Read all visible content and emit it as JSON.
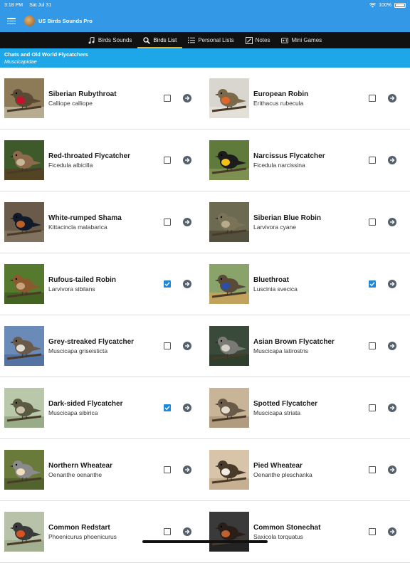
{
  "status_bar": {
    "time": "3:18 PM",
    "date": "Sat Jul 31",
    "battery": "100%"
  },
  "app": {
    "title": "US Birds Sounds Pro"
  },
  "tabs": [
    {
      "label": "Birds Sounds",
      "icon": "music-note-icon",
      "active": false
    },
    {
      "label": "Birds List",
      "icon": "search-icon",
      "active": true
    },
    {
      "label": "Personal Lists",
      "icon": "list-icon",
      "active": false
    },
    {
      "label": "Notes",
      "icon": "edit-note-icon",
      "active": false
    },
    {
      "label": "Mini Games",
      "icon": "gamepad-icon",
      "active": false
    }
  ],
  "section": {
    "title": "Chats and Old World Flycatchers",
    "family": "Muscicapidae"
  },
  "birds": [
    {
      "common": "Siberian Rubythroat",
      "scientific": "Calliope calliope",
      "checked": false,
      "palette": [
        "#8d7a57",
        "#5a4a35",
        "#c8102e",
        "#c9c0a8"
      ]
    },
    {
      "common": "European Robin",
      "scientific": "Erithacus rubecula",
      "checked": false,
      "palette": [
        "#d9d6cf",
        "#7a6a4a",
        "#e2662a",
        "#e8e4dc"
      ]
    },
    {
      "common": "Red-throated Flycatcher",
      "scientific": "Ficedula albicilla",
      "checked": false,
      "palette": [
        "#3f5a2a",
        "#8a6a4a",
        "#c9b79a",
        "#5c3b22"
      ]
    },
    {
      "common": "Narcissus Flycatcher",
      "scientific": "Ficedula narcissina",
      "checked": false,
      "palette": [
        "#5f7a3a",
        "#1c1c1c",
        "#f2c018",
        "#8a9a5a"
      ]
    },
    {
      "common": "White-rumped Shama",
      "scientific": "Kittacincla malabarica",
      "checked": false,
      "palette": [
        "#6a5a4a",
        "#111a2a",
        "#b8602a",
        "#8b7b68"
      ]
    },
    {
      "common": "Siberian Blue Robin",
      "scientific": "Larvivora cyane",
      "checked": false,
      "palette": [
        "#6d6a52",
        "#7a7358",
        "#b7ab8e",
        "#4a4636"
      ]
    },
    {
      "common": "Rufous-tailed Robin",
      "scientific": "Larvivora sibilans",
      "checked": true,
      "palette": [
        "#557a2e",
        "#8a5a2e",
        "#c7a27a",
        "#3d5a1f"
      ]
    },
    {
      "common": "Bluethroat",
      "scientific": "Luscinia svecica",
      "checked": true,
      "palette": [
        "#8aa36a",
        "#5a4a3a",
        "#2a4fa8",
        "#d9a25a"
      ]
    },
    {
      "common": "Grey-streaked Flycatcher",
      "scientific": "Muscicapa griseisticta",
      "checked": false,
      "palette": [
        "#6a8ab8",
        "#6a5a4a",
        "#e0dcd2",
        "#4a6a98"
      ]
    },
    {
      "common": "Asian Brown Flycatcher",
      "scientific": "Muscicapa latirostris",
      "checked": false,
      "palette": [
        "#3a4a3a",
        "#7a7a74",
        "#d4d0c8",
        "#2a3a2a"
      ]
    },
    {
      "common": "Dark-sided Flycatcher",
      "scientific": "Muscicapa sibirica",
      "checked": true,
      "palette": [
        "#b8c8a8",
        "#5a5a42",
        "#c8c0a8",
        "#8ba07a"
      ]
    },
    {
      "common": "Spotted Flycatcher",
      "scientific": "Muscicapa striata",
      "checked": false,
      "palette": [
        "#c8b496",
        "#6a5a48",
        "#e6dccc",
        "#a89276"
      ]
    },
    {
      "common": "Northern Wheatear",
      "scientific": "Oenanthe oenanthe",
      "checked": false,
      "palette": [
        "#6a7a3a",
        "#8a8a8a",
        "#f0e0c0",
        "#4a5a2a"
      ]
    },
    {
      "common": "Pied Wheatear",
      "scientific": "Oenanthe pleschanka",
      "checked": false,
      "palette": [
        "#d8c4a8",
        "#4a3a2a",
        "#f2ece2",
        "#c0a888"
      ]
    },
    {
      "common": "Common Redstart",
      "scientific": "Phoenicurus phoenicurus",
      "checked": false,
      "palette": [
        "#b8c2a8",
        "#3a3a3a",
        "#d8541e",
        "#98a888"
      ]
    },
    {
      "common": "Common Stonechat",
      "scientific": "Saxicola torquatus",
      "checked": false,
      "palette": [
        "#3a3a3a",
        "#2a1e18",
        "#c06030",
        "#1a1a1a"
      ]
    }
  ]
}
